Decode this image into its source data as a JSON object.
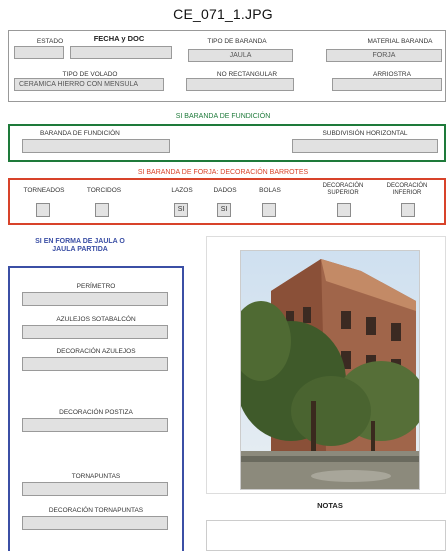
{
  "title": "CE_071_1.JPG",
  "top": {
    "estado": {
      "label": "ESTADO",
      "value": ""
    },
    "fecha": {
      "label": "FECHA y DOC",
      "value": ""
    },
    "tipo_baranda": {
      "label": "TIPO DE BARANDA",
      "value": "JAULA"
    },
    "material": {
      "label": "MATERIAL BARANDA",
      "value": "FORJA"
    },
    "tipo_volado": {
      "label": "TIPO DE VOLADO",
      "value": "CERAMICA HIERRO CON MENSULA"
    },
    "no_rectangular": {
      "label": "NO RECTANGULAR",
      "value": ""
    },
    "arriostra": {
      "label": "ARRIOSTRA",
      "value": ""
    }
  },
  "fundicion": {
    "header": "SI BARANDA DE FUNDICIÓN",
    "baranda_label": "BARANDA DE FUNDICIÓN",
    "subdivision_label": "SUBDIVISIÓN HORIZONTAL"
  },
  "forja": {
    "header": "SI BARANDA DE FORJA: DECORACIÓN BARROTES",
    "items": [
      {
        "label": "TORNEADOS",
        "value": ""
      },
      {
        "label": "TORCIDOS",
        "value": ""
      },
      {
        "label": "LAZOS",
        "value": "SI"
      },
      {
        "label": "DADOS",
        "value": "SI"
      },
      {
        "label": "BOLAS",
        "value": ""
      },
      {
        "label": "DECORACIÓN SUPERIOR",
        "value": ""
      },
      {
        "label": "DECORACIÓN INFERIOR",
        "value": ""
      }
    ]
  },
  "jaula": {
    "header": "SI EN FORMA DE JAULA O JAULA PARTIDA",
    "fields": [
      "PERÍMETRO",
      "AZULEJOS SOTABALCÓN",
      "DECORACIÓN AZULEJOS",
      "DECORACIÓN POSTIZA",
      "TORNAPUNTAS",
      "DECORACIÓN TORNAPUNTAS"
    ]
  },
  "notas_label": "NOTAS",
  "colors": {
    "green": "#1e7a3a",
    "red": "#d8432a",
    "blue": "#3b4fa5"
  }
}
